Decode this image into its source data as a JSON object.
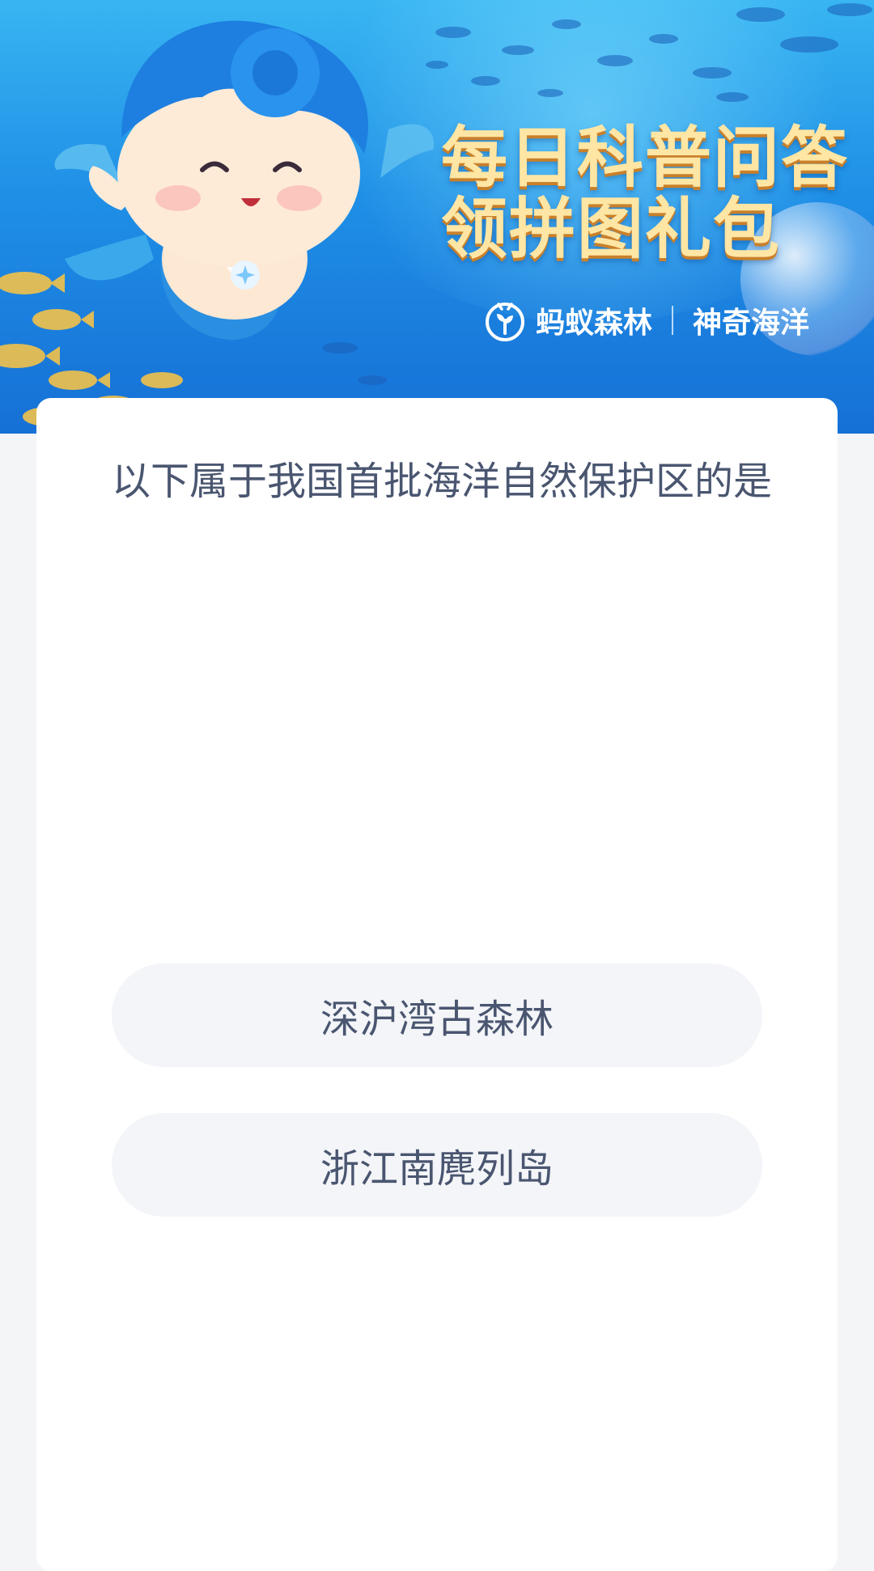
{
  "banner": {
    "title_line1": "每日科普问答",
    "title_line2": "领拼图礼包",
    "brand_left": "蚂蚁森林",
    "brand_right": "神奇海洋"
  },
  "quiz": {
    "question": "以下属于我国首批海洋自然保护区的是",
    "options": [
      {
        "label": "深沪湾古森林"
      },
      {
        "label": "浙江南麂列岛"
      }
    ]
  },
  "colors": {
    "banner_blue": "#1f8fe6",
    "title_gold": "#ffe6a4",
    "text": "#4a5670",
    "option_bg": "#f3f5f8",
    "page_bg": "#f4f5f7"
  }
}
